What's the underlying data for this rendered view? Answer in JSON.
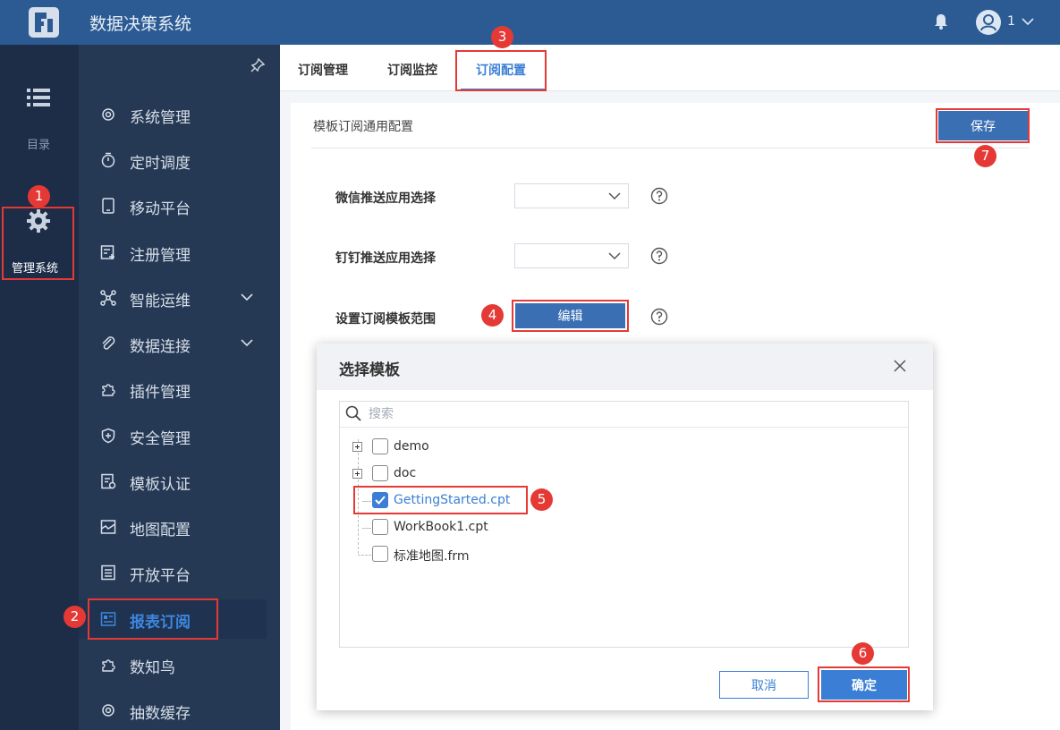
{
  "app": {
    "title": "数据决策系统",
    "user": "1"
  },
  "rail": {
    "menu_label": "目录",
    "manage_label": "管理系统"
  },
  "sidebar": {
    "items": [
      {
        "label": "系统管理",
        "icon": "gear-icon"
      },
      {
        "label": "定时调度",
        "icon": "timer-icon"
      },
      {
        "label": "移动平台",
        "icon": "tablet-icon"
      },
      {
        "label": "注册管理",
        "icon": "register-icon"
      },
      {
        "label": "智能运维",
        "icon": "network-icon",
        "expandable": true
      },
      {
        "label": "数据连接",
        "icon": "link-icon",
        "expandable": true
      },
      {
        "label": "插件管理",
        "icon": "puzzle-icon"
      },
      {
        "label": "安全管理",
        "icon": "shield-icon"
      },
      {
        "label": "模板认证",
        "icon": "certificate-icon"
      },
      {
        "label": "地图配置",
        "icon": "map-icon"
      },
      {
        "label": "开放平台",
        "icon": "list-icon"
      },
      {
        "label": "报表订阅",
        "icon": "report-icon",
        "active": true
      },
      {
        "label": "数知鸟",
        "icon": "puzzle-icon"
      },
      {
        "label": "抽数缓存",
        "icon": "gear-icon"
      }
    ]
  },
  "tabs": [
    {
      "label": "订阅管理"
    },
    {
      "label": "订阅监控"
    },
    {
      "label": "订阅配置",
      "active": true
    }
  ],
  "config": {
    "section_title": "模板订阅通用配置",
    "save_label": "保存",
    "wechat_label": "微信推送应用选择",
    "dingtalk_label": "钉钉推送应用选择",
    "scope_label": "设置订阅模板范围",
    "edit_label": "编辑"
  },
  "dialog": {
    "title": "选择模板",
    "search_placeholder": "搜索",
    "tree": [
      {
        "label": "demo",
        "folder": true,
        "checked": false
      },
      {
        "label": "doc",
        "folder": true,
        "checked": false
      },
      {
        "label": "GettingStarted.cpt",
        "folder": false,
        "checked": true
      },
      {
        "label": "WorkBook1.cpt",
        "folder": false,
        "checked": false
      },
      {
        "label": "标准地图.frm",
        "folder": false,
        "checked": false
      }
    ],
    "cancel_label": "取消",
    "ok_label": "确定"
  },
  "steps": [
    "1",
    "2",
    "3",
    "4",
    "5",
    "6",
    "7"
  ],
  "colors": {
    "header": "#2c5b93",
    "accent": "#3a7fd5",
    "highlight": "#e53935"
  }
}
